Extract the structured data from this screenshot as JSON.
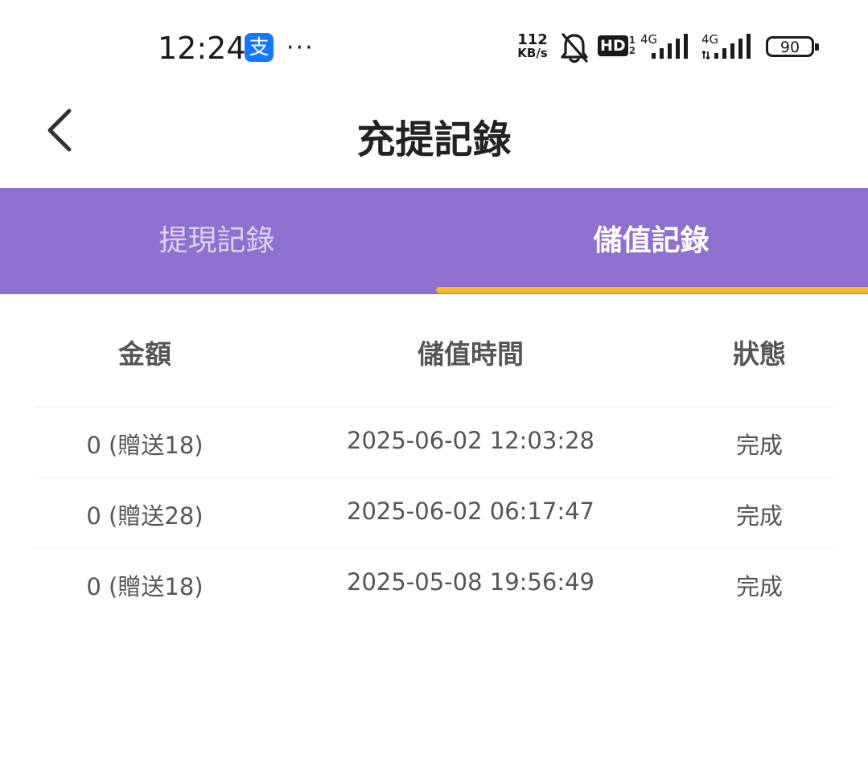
{
  "status_bar": {
    "time": "12:24",
    "app_badge": "支",
    "more": "···",
    "net_speed_value": "112",
    "net_speed_unit": "KB/s",
    "hd_label": "HD",
    "hd_frac_top": "1",
    "hd_frac_bottom": "2",
    "sim1_network": "4G",
    "sim2_network": "4G",
    "battery": "90"
  },
  "header": {
    "title": "充提記錄"
  },
  "tabs": [
    {
      "label": "提現記錄",
      "active": false
    },
    {
      "label": "儲值記錄",
      "active": true
    }
  ],
  "table": {
    "columns": [
      "金額",
      "儲值時間",
      "狀態"
    ],
    "rows": [
      {
        "amount": "0 (贈送18)",
        "time": "2025-06-02 12:03:28",
        "status": "完成"
      },
      {
        "amount": "0 (贈送28)",
        "time": "2025-06-02 06:17:47",
        "status": "完成"
      },
      {
        "amount": "0 (贈送18)",
        "time": "2025-05-08 19:56:49",
        "status": "完成"
      }
    ]
  },
  "colors": {
    "tab_bar": "#8e70cf",
    "indicator": "#f0b92c",
    "alipay": "#1677ff"
  }
}
